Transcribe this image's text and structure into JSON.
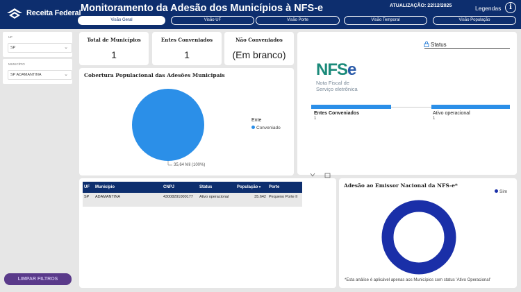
{
  "header": {
    "logo_text": "Receita Federal",
    "title": "Monitoramento da Adesão dos Municípios à NFS-e",
    "update": "ATUALIZAÇÃO: 22/12/2025",
    "legend_link": "Legendas",
    "info_icon": "i"
  },
  "tabs": [
    "Visão Geral",
    "Visão UF",
    "Visão Porte",
    "Visão Temporal",
    "Visão População"
  ],
  "filters": {
    "uf_label": "UF",
    "uf_value": "SP",
    "municipio_label": "MUNICÍPIO",
    "municipio_value": "SP ADAMANTINA",
    "clear_button": "LIMPAR FILTROS"
  },
  "kpis": {
    "total_title": "Total de Municípios",
    "total_value": "1",
    "entes_title": "Entes Conveniados",
    "entes_value": "1",
    "nao_title": "Não Conveniados",
    "nao_value": "(Em branco)"
  },
  "coverage": {
    "title": "Cobertura Populacional das Adesões Municipais",
    "legend_title": "Ente",
    "legend_item": "Conveniado",
    "slice_label": "35,64 Mil (100%)",
    "color": "#2b8fe8"
  },
  "nfse": {
    "logo_word": "NFSe",
    "logo_line1": "Nota Fiscal de",
    "logo_line2": "Serviço eletrônica",
    "status_label": "Status",
    "bar_left_label": "Entes Conveniados",
    "bar_left_value": "1",
    "bar_right_label": "Ativo operacional",
    "bar_right_value": "1"
  },
  "table": {
    "headers": [
      "UF",
      "Município",
      "CNPJ",
      "Status",
      "População",
      "Porte"
    ],
    "rows": [
      [
        "SP",
        "ADAMANTINA",
        "43008291000177",
        "Ativo operacional",
        "35.642",
        "Pequeno Porte II"
      ]
    ]
  },
  "emissor": {
    "title": "Adesão ao Emissor Nacional da NFS-e*",
    "legend_item": "Sim",
    "color": "#1a2fa8",
    "footnote": "*Esta análise é aplicável apenas aos Municípios com status 'Ativo Operacional'"
  }
}
